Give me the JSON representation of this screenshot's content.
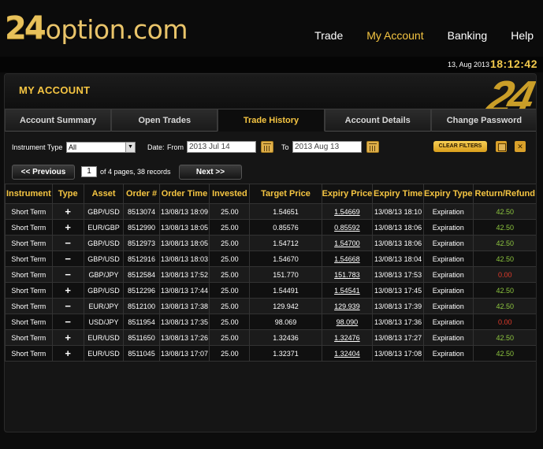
{
  "brand": {
    "logo_number": "24",
    "logo_text": "option.com"
  },
  "nav": [
    {
      "label": "Trade",
      "active": false
    },
    {
      "label": "My Account",
      "active": true
    },
    {
      "label": "Banking",
      "active": false
    },
    {
      "label": "Help",
      "active": false
    }
  ],
  "status": {
    "date": "13, Aug 2013",
    "time": "18:12:42"
  },
  "panel": {
    "title": "MY ACCOUNT",
    "watermark": "24"
  },
  "tabs": [
    {
      "label": "Account Summary",
      "active": false
    },
    {
      "label": "Open Trades",
      "active": false
    },
    {
      "label": "Trade History",
      "active": true
    },
    {
      "label": "Account Details",
      "active": false
    },
    {
      "label": "Change Password",
      "active": false
    }
  ],
  "filters": {
    "instrument_label": "Instrument Type",
    "instrument_value": "All",
    "date_label": "Date:",
    "from_label": "From",
    "from_value": "2013 Jul 14",
    "to_label": "To",
    "to_value": "2013 Aug 13",
    "clear_label": "CLEAR FILTERS"
  },
  "pager": {
    "prev_label": "<< Previous",
    "page_value": "1",
    "info": "of 4 pages, 38 records",
    "next_label": "Next >>"
  },
  "colors": {
    "accent": "#f5c542",
    "positive": "#8dc63f",
    "negative": "#e43b2b"
  },
  "table": {
    "headers": [
      "Instrument",
      "Type",
      "Asset",
      "Order #",
      "Order Time",
      "Invested",
      "Target Price",
      "Expiry Price",
      "Expiry Time",
      "Expiry Type",
      "Return/Refund"
    ],
    "rows": [
      {
        "instrument": "Short Term",
        "type": "+",
        "asset": "GBP/USD",
        "order": "8513074",
        "order_time": "13/08/13 18:09",
        "invested": "25.00",
        "target": "1.54651",
        "expiry_price": "1.54669",
        "expiry_time": "13/08/13 18:10",
        "expiry_type": "Expiration",
        "return": "42.50"
      },
      {
        "instrument": "Short Term",
        "type": "+",
        "asset": "EUR/GBP",
        "order": "8512990",
        "order_time": "13/08/13 18:05",
        "invested": "25.00",
        "target": "0.85576",
        "expiry_price": "0.85592",
        "expiry_time": "13/08/13 18:06",
        "expiry_type": "Expiration",
        "return": "42.50"
      },
      {
        "instrument": "Short Term",
        "type": "−",
        "asset": "GBP/USD",
        "order": "8512973",
        "order_time": "13/08/13 18:05",
        "invested": "25.00",
        "target": "1.54712",
        "expiry_price": "1.54700",
        "expiry_time": "13/08/13 18:06",
        "expiry_type": "Expiration",
        "return": "42.50"
      },
      {
        "instrument": "Short Term",
        "type": "−",
        "asset": "GBP/USD",
        "order": "8512916",
        "order_time": "13/08/13 18:03",
        "invested": "25.00",
        "target": "1.54670",
        "expiry_price": "1.54668",
        "expiry_time": "13/08/13 18:04",
        "expiry_type": "Expiration",
        "return": "42.50"
      },
      {
        "instrument": "Short Term",
        "type": "−",
        "asset": "GBP/JPY",
        "order": "8512584",
        "order_time": "13/08/13 17:52",
        "invested": "25.00",
        "target": "151.770",
        "expiry_price": "151.783",
        "expiry_time": "13/08/13 17:53",
        "expiry_type": "Expiration",
        "return": "0.00"
      },
      {
        "instrument": "Short Term",
        "type": "+",
        "asset": "GBP/USD",
        "order": "8512296",
        "order_time": "13/08/13 17:44",
        "invested": "25.00",
        "target": "1.54491",
        "expiry_price": "1.54541",
        "expiry_time": "13/08/13 17:45",
        "expiry_type": "Expiration",
        "return": "42.50"
      },
      {
        "instrument": "Short Term",
        "type": "−",
        "asset": "EUR/JPY",
        "order": "8512100",
        "order_time": "13/08/13 17:38",
        "invested": "25.00",
        "target": "129.942",
        "expiry_price": "129.939",
        "expiry_time": "13/08/13 17:39",
        "expiry_type": "Expiration",
        "return": "42.50"
      },
      {
        "instrument": "Short Term",
        "type": "−",
        "asset": "USD/JPY",
        "order": "8511954",
        "order_time": "13/08/13 17:35",
        "invested": "25.00",
        "target": "98.069",
        "expiry_price": "98.090",
        "expiry_time": "13/08/13 17:36",
        "expiry_type": "Expiration",
        "return": "0.00"
      },
      {
        "instrument": "Short Term",
        "type": "+",
        "asset": "EUR/USD",
        "order": "8511650",
        "order_time": "13/08/13 17:26",
        "invested": "25.00",
        "target": "1.32436",
        "expiry_price": "1.32476",
        "expiry_time": "13/08/13 17:27",
        "expiry_type": "Expiration",
        "return": "42.50"
      },
      {
        "instrument": "Short Term",
        "type": "+",
        "asset": "EUR/USD",
        "order": "8511045",
        "order_time": "13/08/13 17:07",
        "invested": "25.00",
        "target": "1.32371",
        "expiry_price": "1.32404",
        "expiry_time": "13/08/13 17:08",
        "expiry_type": "Expiration",
        "return": "42.50"
      }
    ]
  }
}
